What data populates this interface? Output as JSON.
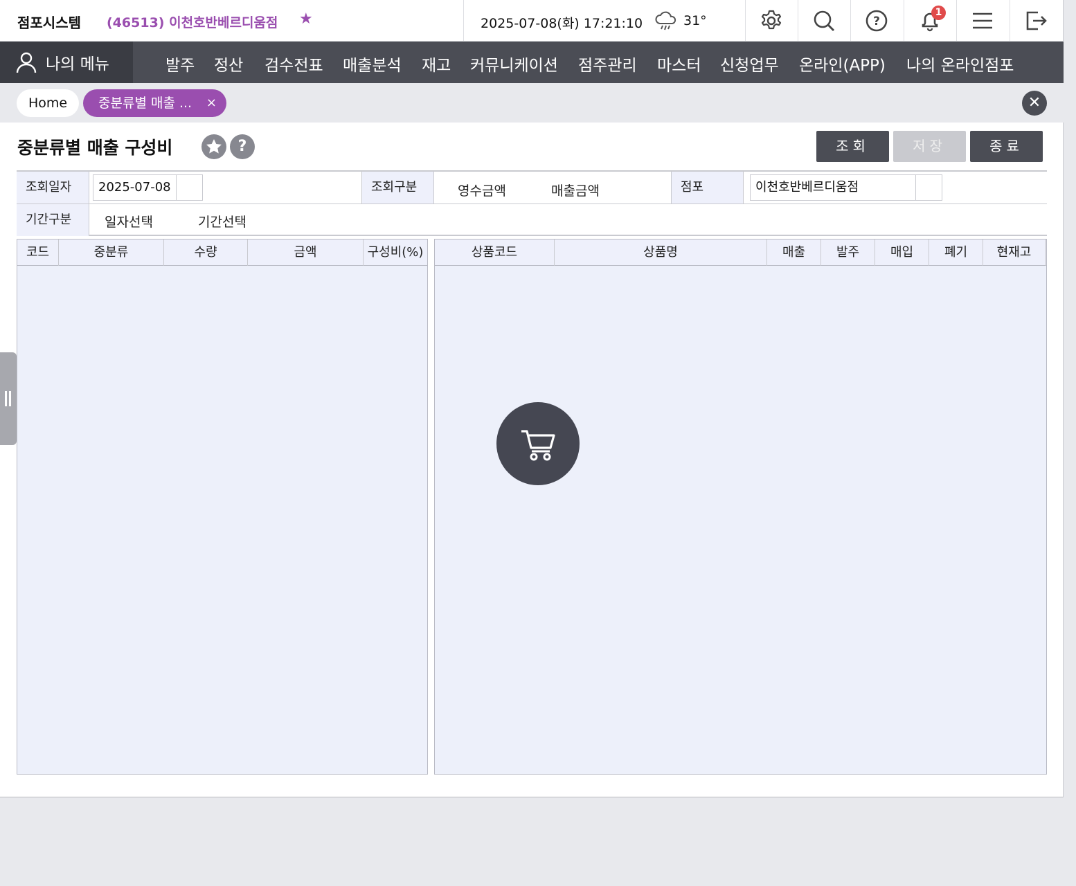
{
  "header": {
    "system_title": "점포시스템",
    "store": "(46513) 이천호반베르디움점",
    "datetime": "2025-07-08(화) 17:21:10",
    "temperature": "31°",
    "notification_count": "1"
  },
  "nav": {
    "my_menu": "나의 메뉴",
    "items": [
      "발주",
      "정산",
      "검수전표",
      "매출분석",
      "재고",
      "커뮤니케이션",
      "점주관리",
      "마스터",
      "신청업무",
      "온라인(APP)",
      "나의 온라인점포"
    ]
  },
  "tabs": {
    "home": "Home",
    "active": "중분류별 매출 ...",
    "active_close": "×",
    "close_all": "✕"
  },
  "page": {
    "title": "중분류별 매출 구성비",
    "help": "?",
    "buttons": {
      "search": "조회",
      "save": "저장",
      "close": "종료"
    }
  },
  "form": {
    "date_label": "조회일자",
    "date_value": "2025-07-08",
    "type_label": "조회구분",
    "type_options": [
      "영수금액",
      "매출금액"
    ],
    "store_label": "점포",
    "store_value": "이천호반베르디움점",
    "period_label": "기간구분",
    "period_options": [
      "일자선택",
      "기간선택"
    ]
  },
  "left_grid": {
    "columns": [
      "코드",
      "중분류",
      "수량",
      "금액",
      "구성비(%)"
    ]
  },
  "right_grid": {
    "columns": [
      "상품코드",
      "상품명",
      "매출",
      "발주",
      "매입",
      "폐기",
      "현재고"
    ]
  },
  "colors": {
    "accent": "#9a4eaf",
    "nav_bg": "#4b4d55",
    "grid_bg": "#edf0fa"
  }
}
